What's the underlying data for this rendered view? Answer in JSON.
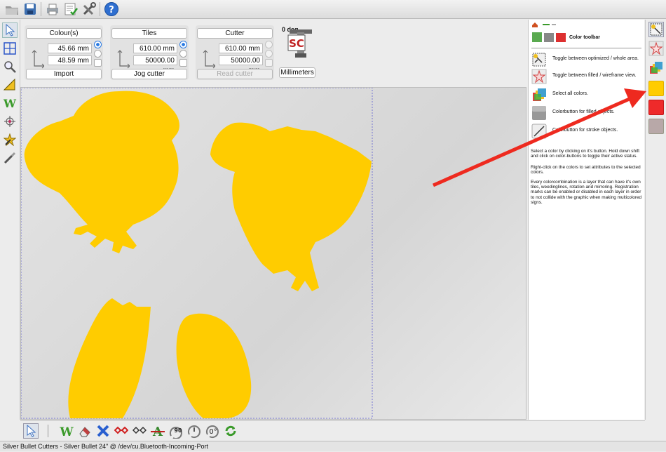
{
  "colors": {
    "shape": "#FFCC00",
    "arrow": "#EE2A1F",
    "accent": "#2A7AE2"
  },
  "top_toolbar": {
    "items": [
      "open-folder-icon",
      "save-icon",
      "print-icon",
      "checklist-icon",
      "tools-icon",
      "help-icon"
    ]
  },
  "param_bar": {
    "colours": {
      "title": "Colour(s)",
      "value1": "45.66 mm",
      "value2": "48.59 mm",
      "button": "Import"
    },
    "tiles": {
      "title": "Tiles",
      "value1": "610.00 mm",
      "value2": "50000.00 mm",
      "button": "Jog cutter"
    },
    "cutter": {
      "title": "Cutter",
      "value1": "610.00 mm",
      "value2": "50000.00 mm",
      "button": "Read cutter"
    },
    "rotation_label": "0 deg",
    "logo_text": "SC",
    "units_button": "Millimeters"
  },
  "help_panel": {
    "title": "Color toolbar",
    "rows": [
      "Toggle between optimized / whole area.",
      "Toggle between filled / wireframe view.",
      "Select all colors.",
      "Colorbutton for filled objects.",
      "Colorbutton for stroke objects."
    ],
    "paragraphs": [
      "Select a color by clicking on it's button. Hold down shift and click on color-buttons to toggle their active status.",
      "Right-click on the colors to set attributes to the selected colors.",
      "Every colorcombination is a layer that can have it's own tiles, weedinglines, rotation and mirroring. Registration marks can be enabled or disabled in each layer in order to not collide with the graphic when making multicolored signs."
    ]
  },
  "bottom_toolbar": {
    "rotate_label": "90",
    "rotate_zero_label": "0°"
  },
  "status_text": "Silver Bullet Cutters - Silver Bullet 24\" @ /dev/cu.Bluetooth-Incoming-Port"
}
